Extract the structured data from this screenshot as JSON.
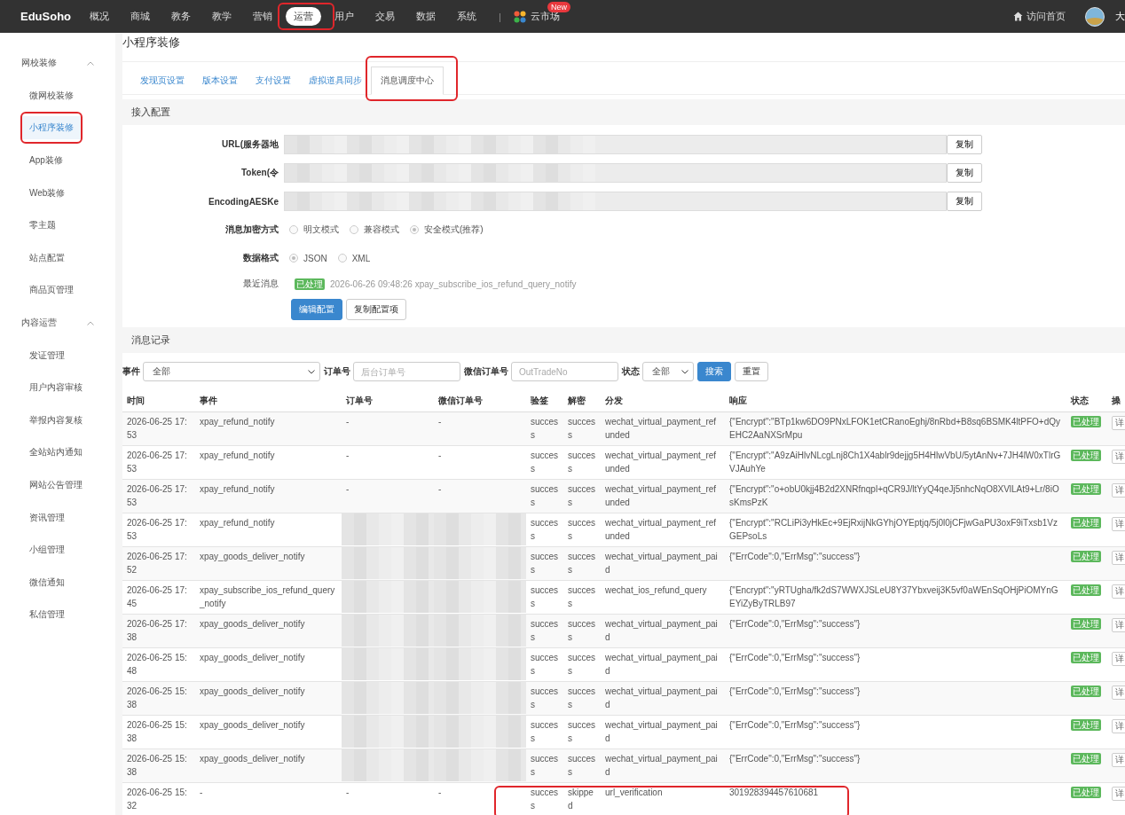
{
  "topbar": {
    "logo": "EduSoho",
    "nav": [
      {
        "label": "概况",
        "selected": false,
        "annotated": false
      },
      {
        "label": "商城",
        "selected": false,
        "annotated": false
      },
      {
        "label": "教务",
        "selected": false,
        "annotated": false
      },
      {
        "label": "教学",
        "selected": false,
        "annotated": false
      },
      {
        "label": "营销",
        "selected": false,
        "annotated": false
      },
      {
        "label": "运营",
        "selected": true,
        "annotated": true
      },
      {
        "label": "用户",
        "selected": false,
        "annotated": false
      },
      {
        "label": "交易",
        "selected": false,
        "annotated": false
      },
      {
        "label": "数据",
        "selected": false,
        "annotated": false
      },
      {
        "label": "系统",
        "selected": false,
        "annotated": false
      }
    ],
    "separator": "|",
    "market": {
      "label": "云市场",
      "badge": "New"
    },
    "home_link": "访问首页",
    "user": "大"
  },
  "sidebar": {
    "groups": [
      {
        "label": "网校装修",
        "expanded": true,
        "items": [
          {
            "label": "微网校装修",
            "selected": false,
            "annotated": false
          },
          {
            "label": "小程序装修",
            "selected": true,
            "annotated": true
          },
          {
            "label": "App装修",
            "selected": false,
            "annotated": false
          },
          {
            "label": "Web装修",
            "selected": false,
            "annotated": false
          },
          {
            "label": "零主题",
            "selected": false,
            "annotated": false
          },
          {
            "label": "站点配置",
            "selected": false,
            "annotated": false
          },
          {
            "label": "商品页管理",
            "selected": false,
            "annotated": false
          }
        ]
      },
      {
        "label": "内容运营",
        "expanded": true,
        "items": [
          {
            "label": "发证管理",
            "selected": false,
            "annotated": false
          },
          {
            "label": "用户内容审核",
            "selected": false,
            "annotated": false
          },
          {
            "label": "举报内容复核",
            "selected": false,
            "annotated": false
          },
          {
            "label": "全站站内通知",
            "selected": false,
            "annotated": false
          },
          {
            "label": "网站公告管理",
            "selected": false,
            "annotated": false
          },
          {
            "label": "资讯管理",
            "selected": false,
            "annotated": false
          },
          {
            "label": "小组管理",
            "selected": false,
            "annotated": false
          },
          {
            "label": "微信通知",
            "selected": false,
            "annotated": false
          },
          {
            "label": "私信管理",
            "selected": false,
            "annotated": false
          }
        ]
      }
    ]
  },
  "page_title": "小程序装修",
  "tabs": [
    {
      "label": "发现页设置",
      "selected": false,
      "annotated": false
    },
    {
      "label": "版本设置",
      "selected": false,
      "annotated": false
    },
    {
      "label": "支付设置",
      "selected": false,
      "annotated": false
    },
    {
      "label": "虚拟道具同步",
      "selected": false,
      "annotated": false
    },
    {
      "label": "消息调度中心",
      "selected": true,
      "annotated": true
    }
  ],
  "access_config": {
    "title": "接入配置",
    "fields": [
      {
        "label": "URL(服务器地",
        "redacted": true,
        "button": "复制"
      },
      {
        "label": "Token(令",
        "redacted": true,
        "button": "复制"
      },
      {
        "label": "EncodingAESKe",
        "redacted": true,
        "button": "复制"
      }
    ],
    "radio_groups": [
      {
        "label": "消息加密方式",
        "options": [
          {
            "label": "明文模式",
            "selected": false
          },
          {
            "label": "兼容模式",
            "selected": false
          },
          {
            "label": "安全模式(推荐)",
            "selected": true
          }
        ]
      },
      {
        "label": "数据格式",
        "options": [
          {
            "label": "JSON",
            "selected": true
          },
          {
            "label": "XML",
            "selected": false
          }
        ]
      }
    ],
    "latest": {
      "label": "最近消息",
      "status": "已处理",
      "text": "2026-06-26 09:48:26 xpay_subscribe_ios_refund_query_notify"
    },
    "buttons": [
      {
        "label": "编辑配置",
        "kind": "primary"
      },
      {
        "label": "复制配置项",
        "kind": "default"
      }
    ]
  },
  "records": {
    "title": "消息记录",
    "filters": [
      {
        "kind": "select",
        "label": "事件",
        "value": "全部"
      },
      {
        "kind": "input",
        "label": "订单号",
        "placeholder": "后台订单号"
      },
      {
        "kind": "input",
        "label": "微信订单号",
        "placeholder": "OutTradeNo"
      },
      {
        "kind": "select",
        "label": "状态",
        "value": "全部"
      },
      {
        "kind": "button",
        "label": "搜索",
        "primary": true
      },
      {
        "kind": "button",
        "label": "重置",
        "primary": false
      }
    ],
    "columns": [
      "时间",
      "事件",
      "订单号",
      "微信订单号",
      "验签",
      "解密",
      "分发",
      "响应",
      "状态",
      "操"
    ],
    "rows": [
      {
        "time": "2026-06-25 17:53",
        "event": "xpay_refund_notify",
        "order": "-",
        "wx_order": "-",
        "redacted": false,
        "signature": "success",
        "decrypt": "success",
        "dispatch": "wechat_virtual_payment_refunded",
        "response": "{\"Encrypt\":\"BTp1kw6DO9PNxLFOK1etCRanoEghj/8nRbd+B8sq6BSMK4ltPFO+dQyEHC2AaNXSrMpu",
        "status": "已处理",
        "action": "详",
        "annotated": false
      },
      {
        "time": "2026-06-25 17:53",
        "event": "xpay_refund_notify",
        "order": "-",
        "wx_order": "-",
        "redacted": false,
        "signature": "success",
        "decrypt": "success",
        "dispatch": "wechat_virtual_payment_refunded",
        "response": "{\"Encrypt\":\"A9zAiHlvNLcgLnj8Ch1X4ablr9dejjg5H4HlwVbU/5ytAnNv+7JH4lW0xTlrGVJAuhYe",
        "status": "已处理",
        "action": "详",
        "annotated": false
      },
      {
        "time": "2026-06-25 17:53",
        "event": "xpay_refund_notify",
        "order": "-",
        "wx_order": "-",
        "redacted": false,
        "signature": "success",
        "decrypt": "success",
        "dispatch": "wechat_virtual_payment_refunded",
        "response": "{\"Encrypt\":\"o+obU0kjj4B2d2XNRfnqpl+qCR9J/ltYyQ4qeJj5nhcNqO8XVlLAt9+Lr/8iOsKmsPzK",
        "status": "已处理",
        "action": "详",
        "annotated": false
      },
      {
        "time": "2026-06-25 17:53",
        "event": "xpay_refund_notify",
        "redacted": true,
        "signature": "success",
        "decrypt": "success",
        "dispatch": "wechat_virtual_payment_refunded",
        "response": "{\"Encrypt\":\"RCLiPi3yHkEc+9EjRxijNkGYhjOYEptjq/5j0l0jCFjwGaPU3oxF9iTxsb1VzGEPsoLs",
        "status": "已处理",
        "action": "详",
        "annotated": false
      },
      {
        "time": "2026-06-25 17:52",
        "event": "xpay_goods_deliver_notify",
        "redacted": true,
        "signature": "success",
        "decrypt": "success",
        "dispatch": "wechat_virtual_payment_paid",
        "response": "{\"ErrCode\":0,\"ErrMsg\":\"success\"}",
        "status": "已处理",
        "action": "详",
        "annotated": false
      },
      {
        "time": "2026-06-25 17:45",
        "event": "xpay_subscribe_ios_refund_query_notify",
        "redacted": true,
        "signature": "success",
        "decrypt": "success",
        "dispatch": "wechat_ios_refund_query",
        "response": "{\"Encrypt\":\"yRTUgha/fk2dS7WWXJSLeU8Y37Ybxveij3K5vf0aWEnSqOHjPiOMYnGEYiZyByTRLB97",
        "status": "已处理",
        "action": "详",
        "annotated": false
      },
      {
        "time": "2026-06-25 17:38",
        "event": "xpay_goods_deliver_notify",
        "redacted": true,
        "signature": "success",
        "decrypt": "success",
        "dispatch": "wechat_virtual_payment_paid",
        "response": "{\"ErrCode\":0,\"ErrMsg\":\"success\"}",
        "status": "已处理",
        "action": "详",
        "annotated": false
      },
      {
        "time": "2026-06-25 15:48",
        "event": "xpay_goods_deliver_notify",
        "redacted": true,
        "signature": "success",
        "decrypt": "success",
        "dispatch": "wechat_virtual_payment_paid",
        "response": "{\"ErrCode\":0,\"ErrMsg\":\"success\"}",
        "status": "已处理",
        "action": "详",
        "annotated": false
      },
      {
        "time": "2026-06-25 15:38",
        "event": "xpay_goods_deliver_notify",
        "redacted": true,
        "signature": "success",
        "decrypt": "success",
        "dispatch": "wechat_virtual_payment_paid",
        "response": "{\"ErrCode\":0,\"ErrMsg\":\"success\"}",
        "status": "已处理",
        "action": "详",
        "annotated": false
      },
      {
        "time": "2026-06-25 15:38",
        "event": "xpay_goods_deliver_notify",
        "redacted": true,
        "signature": "success",
        "decrypt": "success",
        "dispatch": "wechat_virtual_payment_paid",
        "response": "{\"ErrCode\":0,\"ErrMsg\":\"success\"}",
        "status": "已处理",
        "action": "详",
        "annotated": false
      },
      {
        "time": "2026-06-25 15:38",
        "event": "xpay_goods_deliver_notify",
        "redacted": true,
        "signature": "success",
        "decrypt": "success",
        "dispatch": "wechat_virtual_payment_paid",
        "response": "{\"ErrCode\":0,\"ErrMsg\":\"success\"}",
        "status": "已处理",
        "action": "详",
        "annotated": false
      },
      {
        "time": "2026-06-25 15:32",
        "event": "-",
        "order": "-",
        "wx_order": "-",
        "redacted": false,
        "signature": "success",
        "decrypt": "skipped",
        "dispatch": "url_verification",
        "response": "301928394457610681",
        "status": "已处理",
        "action": "详",
        "annotated": true
      }
    ]
  }
}
